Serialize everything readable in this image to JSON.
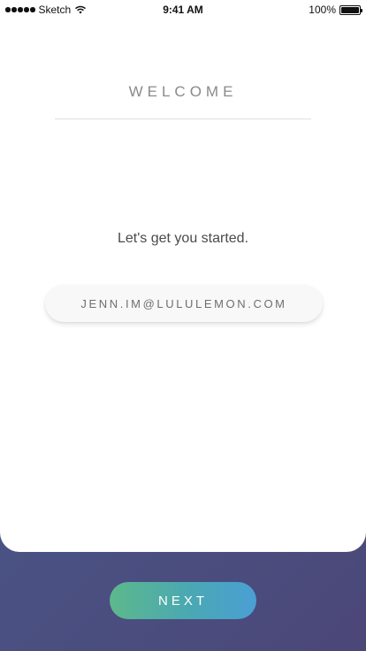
{
  "status_bar": {
    "carrier": "Sketch",
    "time": "9:41 AM",
    "battery": "100%"
  },
  "header": {
    "title": "WELCOME"
  },
  "main": {
    "subtitle": "Let's get you started.",
    "email_value": "JENN.IM@LULULEMON.COM"
  },
  "footer": {
    "next_label": "NEXT"
  },
  "colors": {
    "background_gradient_start": "#3f5d8a",
    "background_gradient_end": "#4b4778",
    "button_gradient_start": "#5db88c",
    "button_gradient_end": "#4a9fd4"
  },
  "icons": [
    "signal-icon",
    "wifi-icon",
    "battery-icon"
  ]
}
